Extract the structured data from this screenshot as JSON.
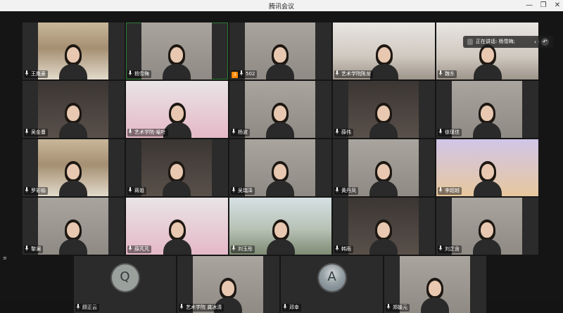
{
  "window": {
    "title": "腾讯会议",
    "minimize_label": "—",
    "restore_label": "❐",
    "close_label": "✕"
  },
  "speaker": {
    "label": "正在讲话: 杨雪梅;",
    "actions": [
      "‹",
      "↶"
    ]
  },
  "rows": [
    [
      {
        "name": "王鹰豪",
        "bg": "shelf"
      },
      {
        "name": "杨雪梅",
        "bg": "room",
        "speaking": true
      },
      {
        "name": "502",
        "bg": "room",
        "badge": "3"
      },
      {
        "name": "艺术学院陈龙",
        "bg": "office"
      },
      {
        "name": "魏东",
        "bg": "office"
      }
    ],
    [
      {
        "name": "吴金蔓",
        "bg": "dark"
      },
      {
        "name": "艺术学院-喻叶",
        "bg": "pink"
      },
      {
        "name": "杨波",
        "bg": "room"
      },
      {
        "name": "薛伟",
        "bg": "dark"
      },
      {
        "name": "徐瑾佳",
        "bg": "room"
      }
    ],
    [
      {
        "name": "罗彩榆",
        "bg": "shelf"
      },
      {
        "name": "蒋姐",
        "bg": "dark"
      },
      {
        "name": "吴瑞泽",
        "bg": "room"
      },
      {
        "name": "黄丹凤",
        "bg": "room"
      },
      {
        "name": "李超越",
        "bg": "art"
      }
    ],
    [
      {
        "name": "黎澜",
        "bg": "room"
      },
      {
        "name": "薛芃芃",
        "bg": "pink"
      },
      {
        "name": "刘玉彤",
        "bg": "outdoor"
      },
      {
        "name": "韩雨",
        "bg": "dark"
      },
      {
        "name": "刘芷含",
        "bg": "room"
      }
    ]
  ],
  "bottom_row": [
    {
      "name": "顾正云",
      "avatar": true,
      "avatar_glyph": "Q"
    },
    {
      "name": "艺术学院 龚冰清",
      "bg": "room"
    },
    {
      "name": "邓幸",
      "avatar": true,
      "avatar_glyph": "A"
    },
    {
      "name": "郑媛元",
      "bg": "room"
    }
  ]
}
